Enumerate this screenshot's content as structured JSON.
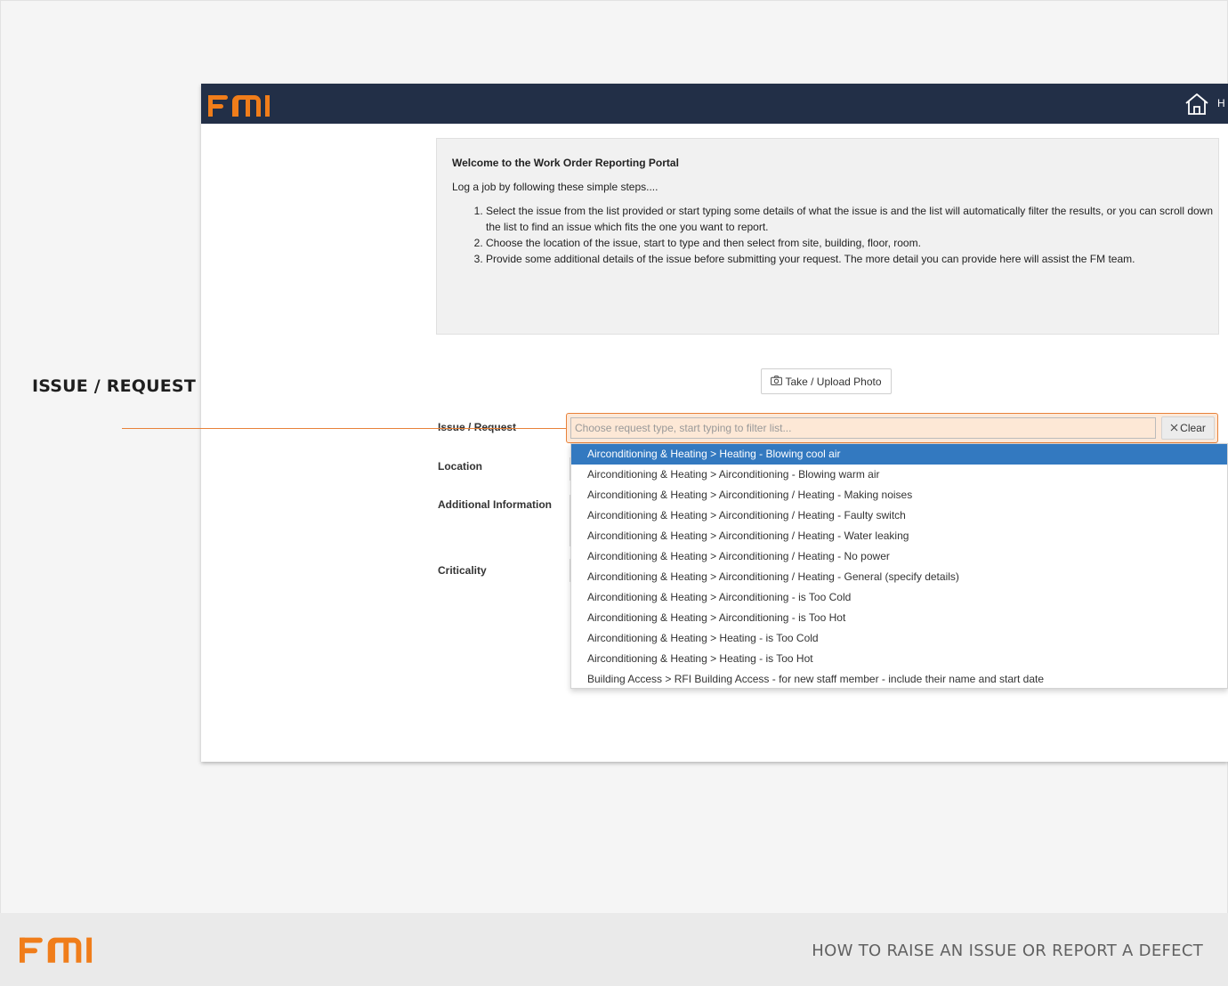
{
  "annotation": {
    "label": "ISSUE / REQUEST"
  },
  "brand": {
    "logo_text": "FMI",
    "accent": "#f07d1a",
    "navbar_color": "#222f47"
  },
  "navbar": {
    "home_label": "H"
  },
  "welcome": {
    "title": "Welcome to the Work Order Reporting Portal",
    "intro": "Log a job by following these simple steps....",
    "steps": [
      "Select the issue from the list provided or start typing some details of what the issue is and the list will automatically filter the results, or you can scroll down the list to find an issue which fits the one you want to report.",
      "Choose the location of the issue, start to type and then select from site, building, floor, room.",
      "Provide some additional details of the issue before submitting your request. The more detail you can provide here will assist the FM team."
    ]
  },
  "photo_button": {
    "label": "Take / Upload Photo",
    "icon": "camera-icon"
  },
  "form": {
    "issue_label": "Issue / Request",
    "location_label": "Location",
    "additional_label": "Additional Information",
    "criticality_label": "Criticality",
    "issue_placeholder": "Choose request type, start typing to filter list...",
    "clear_label": "Clear"
  },
  "dropdown": {
    "selected_index": 0,
    "items": [
      "Airconditioning & Heating > Heating - Blowing cool air",
      "Airconditioning & Heating > Airconditioning - Blowing warm air",
      "Airconditioning & Heating > Airconditioning / Heating - Making noises",
      "Airconditioning & Heating > Airconditioning / Heating - Faulty switch",
      "Airconditioning & Heating > Airconditioning / Heating - Water leaking",
      "Airconditioning & Heating > Airconditioning / Heating - No power",
      "Airconditioning & Heating > Airconditioning / Heating - General (specify details)",
      "Airconditioning & Heating > Airconditioning - is Too Cold",
      "Airconditioning & Heating > Airconditioning - is Too Hot",
      "Airconditioning & Heating > Heating - is Too Cold",
      "Airconditioning & Heating > Heating - is Too Hot",
      "Building Access > RFI Building Access - for new staff member - include their name and start date"
    ]
  },
  "footer": {
    "title": "HOW TO RAISE AN ISSUE OR REPORT A DEFECT"
  }
}
